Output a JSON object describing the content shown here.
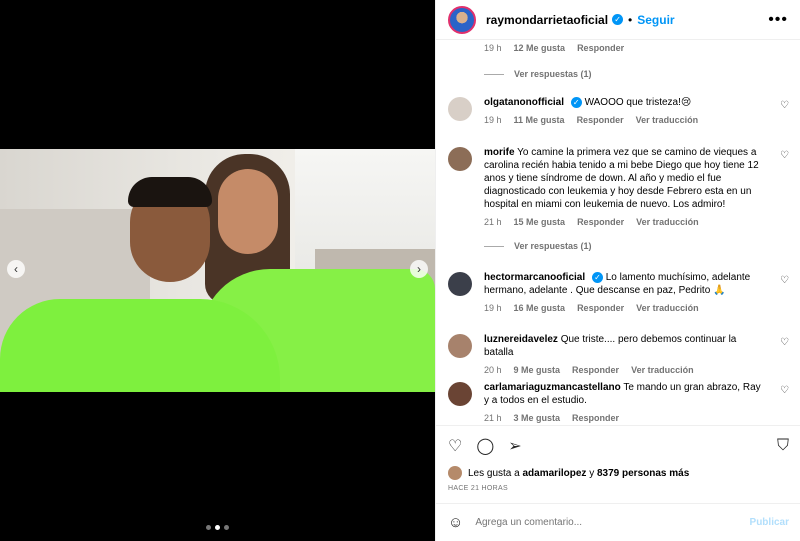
{
  "post": {
    "username": "raymondarrietaoficial",
    "follow_label": "Seguir",
    "separator": "•",
    "more_icon": "more-horizontal-icon"
  },
  "media": {
    "slide_count": 3,
    "active_slide": 2,
    "prev_icon": "chevron-left-icon",
    "next_icon": "chevron-right-icon"
  },
  "comments": {
    "top_partial": {
      "time": "19 h",
      "likes": "12 Me gusta",
      "reply": "Responder"
    },
    "top_replies": "Ver respuestas (1)",
    "items": [
      {
        "user": "olgatanonofficial",
        "verified": true,
        "text": "WAOOO que tristeza!😢",
        "time": "19 h",
        "likes": "11 Me gusta",
        "reply": "Responder",
        "translate": "Ver traducción"
      },
      {
        "user": "morife",
        "verified": false,
        "text": "Yo camine la primera vez que se camino de vieques a carolina recién habia tenido a mi bebe Diego que hoy tiene 12 anos y tiene síndrome de down. Al año y medio el fue diagnosticado con leukemia y hoy desde Febrero esta en un hospital en miami con leukemia de nuevo. Los admiro!",
        "time": "21 h",
        "likes": "15 Me gusta",
        "reply": "Responder",
        "translate": "Ver traducción"
      },
      {
        "user": "hectormarcanooficial",
        "verified": true,
        "text": "Lo lamento muchísimo, adelante hermano, adelante . Que descanse en paz, Pedrito 🙏",
        "time": "19 h",
        "likes": "16 Me gusta",
        "reply": "Responder",
        "translate": "Ver traducción"
      },
      {
        "user": "luznereidavelez",
        "verified": false,
        "text": "Que triste.... pero debemos continuar la batalla",
        "time": "20 h",
        "likes": "9 Me gusta",
        "reply": "Responder",
        "translate": "Ver traducción"
      },
      {
        "user": "carlamariaguzmancastellano",
        "verified": false,
        "text": "Te mando un gran abrazo, Ray y a todos en el estudio.",
        "time": "21 h",
        "likes": "3 Me gusta",
        "reply": "Responder"
      }
    ],
    "morife_replies": "Ver respuestas (1)"
  },
  "footer": {
    "likes_prefix": "Les gusta a",
    "likes_user": "adamarilopez",
    "likes_connector": "y",
    "likes_others": "8379 personas más",
    "timestamp": "HACE 21 HORAS",
    "comment_placeholder": "Agrega un comentario...",
    "publish_label": "Publicar"
  },
  "colors": {
    "accent": "#0095f6",
    "verified": "#0095f6",
    "muted": "#737373",
    "shirt": "#7ef03e"
  }
}
